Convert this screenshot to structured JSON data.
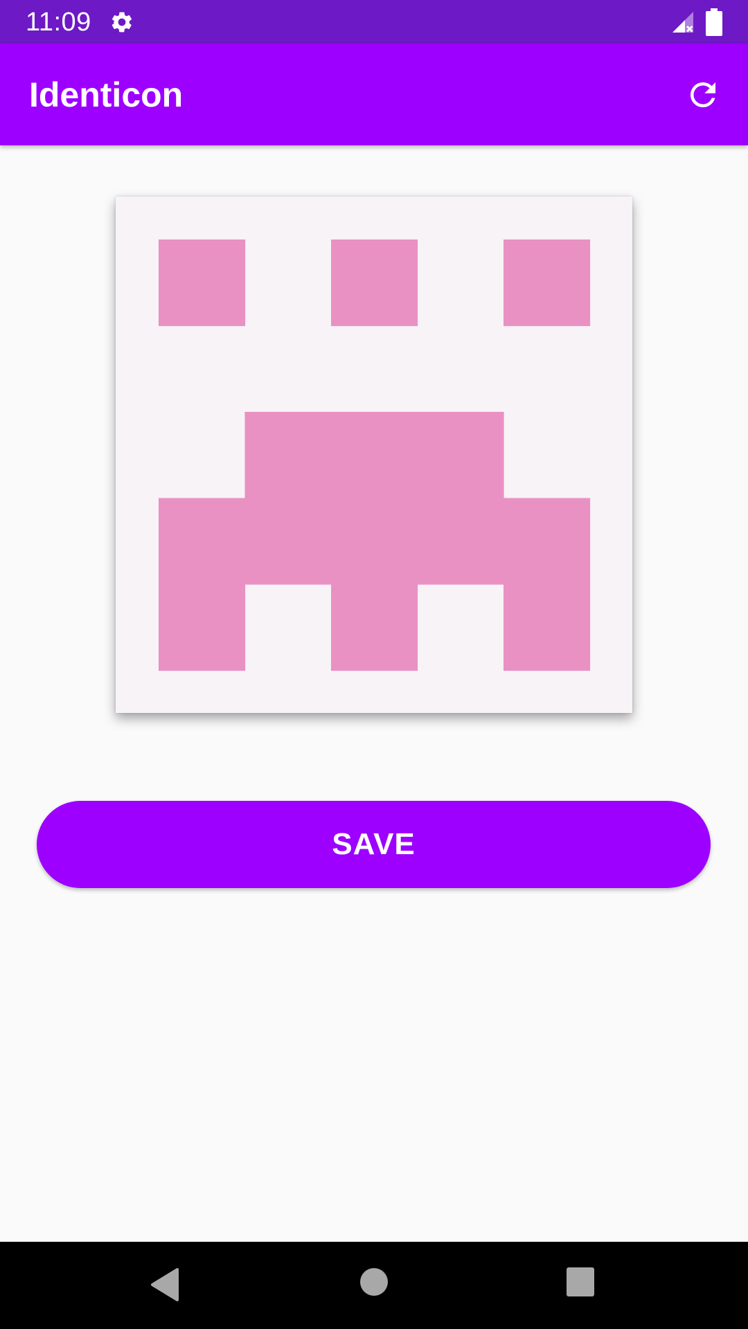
{
  "status_bar": {
    "time": "11:09",
    "icons": [
      "gear-icon",
      "signal-no-service-icon",
      "battery-full-icon"
    ],
    "background_color": "#6e19c6"
  },
  "app_bar": {
    "title": "Identicon",
    "refresh_icon": "refresh-icon",
    "background_color": "#9d00ff"
  },
  "identicon": {
    "grid_size": 5,
    "fill_color": "#e991c3",
    "background_color": "#f7f3f7",
    "cells": [
      [
        1,
        0,
        1,
        0,
        1
      ],
      [
        0,
        0,
        0,
        0,
        0
      ],
      [
        0,
        1,
        1,
        1,
        0
      ],
      [
        1,
        1,
        1,
        1,
        1
      ],
      [
        1,
        0,
        1,
        0,
        1
      ]
    ]
  },
  "save_button": {
    "label": "SAVE",
    "color": "#9d00ff"
  },
  "nav_bar": {
    "icons": [
      "back-icon",
      "home-icon",
      "recents-icon"
    ]
  }
}
